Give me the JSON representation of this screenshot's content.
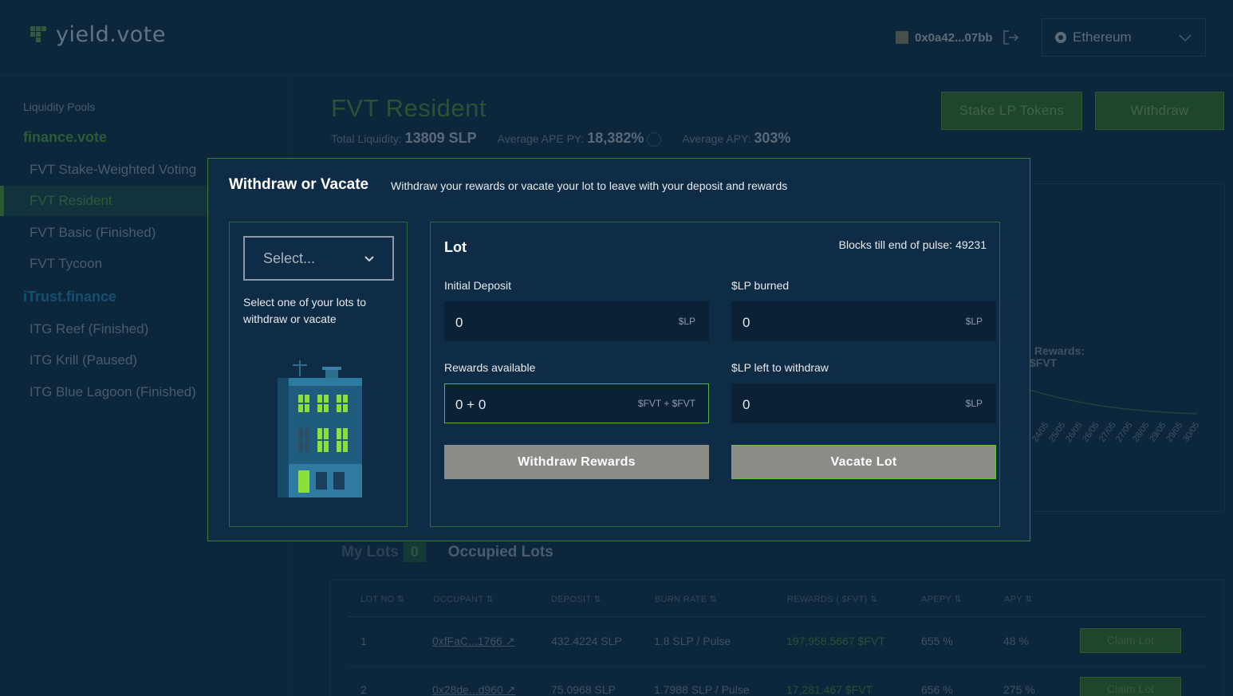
{
  "header": {
    "logo_text": "yield.vote",
    "wallet_address": "0x0a42...07bb",
    "network": "Ethereum"
  },
  "sidebar": {
    "heading": "Liquidity Pools",
    "groups": [
      {
        "name": "finance.vote",
        "color": "#3f7d3d",
        "items": [
          "FVT Stake-Weighted Voting",
          "FVT Resident",
          "FVT Basic (Finished)",
          "FVT Tycoon"
        ]
      },
      {
        "name": "iTrust.finance",
        "color": "#1f6b93",
        "items": [
          "ITG Reef (Finished)",
          "ITG Krill (Paused)",
          "ITG Blue Lagoon (Finished)"
        ]
      }
    ]
  },
  "pool": {
    "title": "FVT Resident",
    "total_liquidity_label": "Total Liquidity:",
    "total_liquidity_value": "13809 SLP",
    "avg_apepy_label": "Average APE PY:",
    "avg_apepy_value": "18,382%",
    "avg_apy_label": "Average APY:",
    "avg_apy_value": "303%",
    "stake_button": "Stake LP Tokens",
    "withdraw_button": "Withdraw"
  },
  "chart": {
    "legend_line1": "Rewards:",
    "legend_line2": "$FVT",
    "ticks": [
      "24/05",
      "25/05",
      "26/05",
      "26/05",
      "27/05",
      "27/05",
      "28/05",
      "29/05",
      "29/05",
      "30/05"
    ]
  },
  "lots": {
    "my_lots_tab": "My Lots",
    "my_lots_count": "0",
    "occupied_tab": "Occupied Lots",
    "columns": [
      "LOT NO ⇅",
      "OCCUPANT ⇅",
      "DEPOSIT ⇅",
      "BURN RATE ⇅",
      "REWARDS ( $FVT) ⇅",
      "APEPY ⇅",
      "APY ⇅"
    ],
    "rows": [
      {
        "lot": "1",
        "occupant": "0xfFaC...1766",
        "deposit": "432.4224 SLP",
        "burn": "1.8 SLP / Pulse",
        "rewards": "197,958.5667 $FVT",
        "apepy": "655 %",
        "apy": "48 %",
        "action": "Claim Lot"
      },
      {
        "lot": "2",
        "occupant": "0x28de...d960",
        "deposit": "75.0968 SLP",
        "burn": "1.7988 SLP / Pulse",
        "rewards": "17,281.467 $FVT",
        "apepy": "656 %",
        "apy": "275 %",
        "action": "Claim Lot"
      }
    ]
  },
  "modal": {
    "title": "Withdraw or Vacate",
    "subtitle": "Withdraw your rewards or vacate your lot to leave with your deposit and rewards",
    "select_placeholder": "Select...",
    "select_help": "Select one of your lots to withdraw or vacate",
    "lot_title": "Lot",
    "blocks_label": "Blocks till end of pulse:",
    "blocks_value": "49231",
    "initial_deposit_label": "Initial Deposit",
    "initial_deposit_value": "0",
    "initial_deposit_unit": "$LP",
    "lp_burned_label": "$LP burned",
    "lp_burned_value": "0",
    "lp_burned_unit": "$LP",
    "rewards_label": "Rewards available",
    "rewards_value": "0 + 0",
    "rewards_unit": "$FVT + $FVT",
    "lp_left_label": "$LP left to withdraw",
    "lp_left_value": "0",
    "lp_left_unit": "$LP",
    "withdraw_rewards_button": "Withdraw Rewards",
    "vacate_button": "Vacate Lot"
  }
}
